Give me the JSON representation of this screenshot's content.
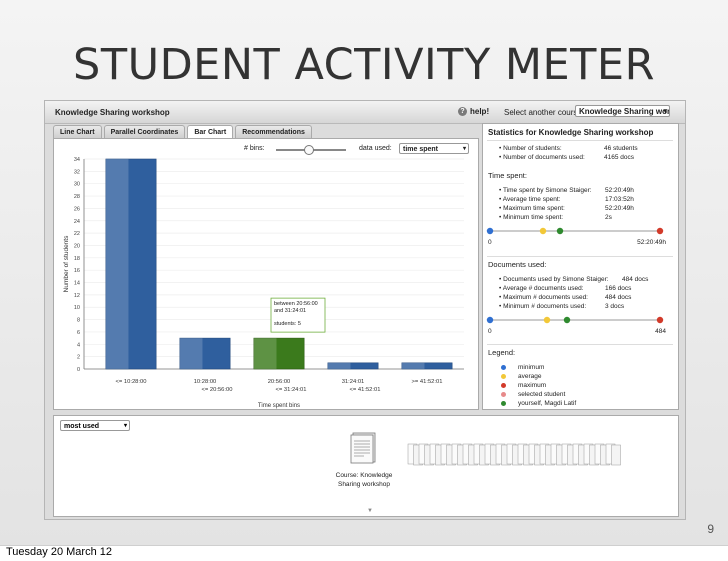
{
  "slide": {
    "title": "STUDENT ACTIVITY METER",
    "number": "9",
    "date": "Tuesday 20 March 12"
  },
  "app": {
    "title": "Knowledge Sharing workshop",
    "help_label": "help!",
    "course_label": "Select another course:",
    "course_value": "Knowledge Sharing worksho",
    "tabs": [
      "Line Chart",
      "Parallel Coordinates",
      "Bar Chart",
      "Recommendations"
    ],
    "active_tab": "Bar Chart",
    "bins_label": "# bins:",
    "data_used_label": "data used:",
    "data_used_value": "time spent",
    "bottom_select": "most used",
    "course_caption": "Course: Knowledge Sharing workshop"
  },
  "stats": {
    "heading": "Statistics for Knowledge Sharing workshop",
    "general": [
      {
        "label": "Number of students:",
        "value": "46 students"
      },
      {
        "label": "Number of documents used:",
        "value": "4165 docs"
      }
    ],
    "time_title": "Time spent:",
    "time": [
      {
        "label": "Time spent by Simone Staiger:",
        "value": "52:20:49h"
      },
      {
        "label": "Average time spent:",
        "value": "17:03:52h"
      },
      {
        "label": "Maximum time spent:",
        "value": "52:20:49h"
      },
      {
        "label": "Minimum time spent:",
        "value": "2s"
      }
    ],
    "time_range": [
      "0",
      "52:20:49h"
    ],
    "docs_title": "Documents used:",
    "docs": [
      {
        "label": "Documents used by Simone Staiger:",
        "value": "484 docs"
      },
      {
        "label": "Average # documents used:",
        "value": "166 docs"
      },
      {
        "label": "Maximum # documents used:",
        "value": "484 docs"
      },
      {
        "label": "Minimum # documents used:",
        "value": "3 docs"
      }
    ],
    "docs_range": [
      "0",
      "484"
    ],
    "legend_title": "Legend:",
    "legend": [
      {
        "label": "minimum",
        "color": "#2f6fd1"
      },
      {
        "label": "average",
        "color": "#f2c838"
      },
      {
        "label": "maximum",
        "color": "#d23a2a"
      },
      {
        "label": "selected student",
        "color": "#e78a8a"
      },
      {
        "label": "yourself, Magdi Latif",
        "color": "#2f8a2f"
      }
    ]
  },
  "chart_data": {
    "type": "bar",
    "categories": [
      "<= 10:28:00",
      "10:28:00\n<= 20:56:00",
      "20:56:00\n<= 31:24:01",
      "31:24:01\n<= 41:52:01",
      ">= 41:52:01"
    ],
    "values": [
      34,
      5,
      5,
      1,
      1
    ],
    "highlight_index": 2,
    "ylabel": "Number of students",
    "xlabel": "Time spent bins",
    "ylim": [
      0,
      34
    ],
    "yticks": [
      0,
      2,
      4,
      6,
      8,
      10,
      12,
      14,
      16,
      18,
      20,
      22,
      24,
      26,
      28,
      30,
      32,
      34
    ],
    "tooltip": [
      "between 20:56:00",
      "and 31:24:01",
      "students: 5"
    ],
    "colors": {
      "normal": "#2f5f9e",
      "highlight": "#3b7a1c",
      "tooltip_border": "#6fae3c"
    }
  }
}
